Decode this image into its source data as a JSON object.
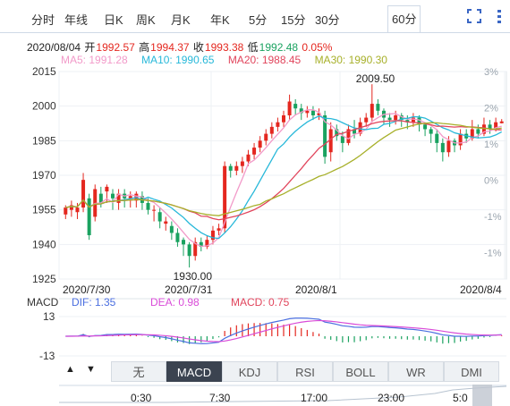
{
  "tabs": [
    "分时",
    "年线",
    "日K",
    "周K",
    "月K",
    "年K",
    "5分",
    "15分",
    "30分",
    "60分"
  ],
  "active_tab": "60分",
  "info": {
    "date": "2020/08/04",
    "open_label": "开",
    "open": "1992.57",
    "high_label": "高",
    "high": "1994.37",
    "close_label": "收",
    "close": "1993.38",
    "low_label": "低",
    "low": "1992.48",
    "change": "0.05%"
  },
  "ma_legend": [
    {
      "label": "MA5: 1991.28",
      "color": "#f29ac9"
    },
    {
      "label": "MA10: 1990.65",
      "color": "#27b8d9"
    },
    {
      "label": "MA20: 1988.45",
      "color": "#e1455c"
    },
    {
      "label": "MA30: 1990.30",
      "color": "#a7b02a"
    }
  ],
  "macd_legend": {
    "title": "MACD",
    "dif": {
      "label": "DIF: 1.35",
      "color": "#4b6fe0"
    },
    "dea": {
      "label": "DEA: 0.98",
      "color": "#d94bd8"
    },
    "macd": {
      "label": "MACD: 0.75",
      "color": "#e1455c"
    }
  },
  "indicator_buttons": [
    "无",
    "MACD",
    "KDJ",
    "RSI",
    "BOLL",
    "WR",
    "DMI"
  ],
  "active_indicator": "MACD",
  "timeline_labels": [
    "0:30",
    "7:30",
    "17:00",
    "23:00",
    "5:0"
  ],
  "colors": {
    "up": "#e4271f",
    "down": "#1aa260"
  },
  "chart_data": {
    "type": "candlestick",
    "y_left_ticks": [
      "2015",
      "2000",
      "1985",
      "1970",
      "1955",
      "1940",
      "1925"
    ],
    "y_right_ticks": [
      "3%",
      "2%",
      "1%",
      "0%",
      "-1%",
      "-1%"
    ],
    "x_labels": [
      "2020/7/30",
      "2020/7/31",
      "2020/8/1",
      "2020/8/4"
    ],
    "ylim": [
      1925,
      2015
    ],
    "annotations": [
      {
        "text": "2009.50",
        "value": 2009.5
      },
      {
        "text": "1930.00",
        "value": 1930.0
      }
    ],
    "candles": [
      [
        1953,
        1956,
        1951,
        1957
      ],
      [
        1955,
        1957,
        1952,
        1959
      ],
      [
        1954,
        1956,
        1951,
        1958
      ],
      [
        1956,
        1968,
        1954,
        1971
      ],
      [
        1960,
        1944,
        1942,
        1962
      ],
      [
        1952,
        1964,
        1950,
        1966
      ],
      [
        1962,
        1958,
        1956,
        1965
      ],
      [
        1963,
        1965,
        1958,
        1966
      ],
      [
        1962,
        1960,
        1955,
        1964
      ],
      [
        1958,
        1962,
        1955,
        1964
      ],
      [
        1962,
        1960,
        1956,
        1964
      ],
      [
        1960,
        1961,
        1956,
        1963
      ],
      [
        1959,
        1962,
        1956,
        1963
      ],
      [
        1961,
        1958,
        1955,
        1963
      ],
      [
        1958,
        1955,
        1953,
        1960
      ],
      [
        1955,
        1955,
        1950,
        1957
      ],
      [
        1954,
        1950,
        1947,
        1956
      ],
      [
        1949,
        1950,
        1946,
        1952
      ],
      [
        1948,
        1945,
        1942,
        1950
      ],
      [
        1945,
        1941,
        1939,
        1947
      ],
      [
        1942,
        1940,
        1935,
        1943
      ],
      [
        1940,
        1935,
        1930,
        1941
      ],
      [
        1935,
        1941,
        1933,
        1943
      ],
      [
        1941,
        1939,
        1937,
        1943
      ],
      [
        1939,
        1942,
        1938,
        1944
      ],
      [
        1942,
        1946,
        1940,
        1948
      ],
      [
        1946,
        1947,
        1944,
        1949
      ],
      [
        1947,
        1974,
        1945,
        1976
      ],
      [
        1974,
        1972,
        1969,
        1975
      ],
      [
        1972,
        1974,
        1970,
        1976
      ],
      [
        1974,
        1976,
        1971,
        1978
      ],
      [
        1976,
        1979,
        1974,
        1981
      ],
      [
        1979,
        1982,
        1977,
        1984
      ],
      [
        1982,
        1985,
        1980,
        1987
      ],
      [
        1985,
        1988,
        1983,
        1990
      ],
      [
        1988,
        1991,
        1986,
        1993
      ],
      [
        1991,
        1993,
        1989,
        1995
      ],
      [
        1993,
        1996,
        1991,
        1998
      ],
      [
        1996,
        2002,
        1994,
        2005
      ],
      [
        2001,
        1999,
        1996,
        2003
      ],
      [
        1999,
        1997,
        1994,
        2001
      ],
      [
        1997,
        1998,
        1995,
        2000
      ],
      [
        1998,
        1996,
        1994,
        2000
      ],
      [
        1996,
        1997,
        1994,
        1999
      ],
      [
        1996,
        1978,
        1975,
        1998
      ],
      [
        1980,
        1990,
        1976,
        1993
      ],
      [
        1990,
        1987,
        1985,
        1992
      ],
      [
        1987,
        1984,
        1980,
        1989
      ],
      [
        1984,
        1990,
        1983,
        1992
      ],
      [
        1990,
        1988,
        1986,
        1994
      ],
      [
        1988,
        1993,
        1987,
        1995
      ],
      [
        1993,
        1995,
        1991,
        1997
      ],
      [
        1995,
        2001,
        1993,
        2009.5
      ],
      [
        2001,
        1998,
        1996,
        2003
      ],
      [
        1998,
        1995,
        1992,
        1999
      ],
      [
        1995,
        1994,
        1991,
        1997
      ],
      [
        1994,
        1996,
        1992,
        1998
      ],
      [
        1996,
        1994,
        1991,
        1997
      ],
      [
        1994,
        1993,
        1990,
        1996
      ],
      [
        1993,
        1995,
        1991,
        1997
      ],
      [
        1995,
        1992,
        1989,
        1996
      ],
      [
        1992,
        1990,
        1987,
        1993
      ],
      [
        1990,
        1988,
        1984,
        1991
      ],
      [
        1988,
        1984,
        1980,
        1990
      ],
      [
        1984,
        1980,
        1976,
        1986
      ],
      [
        1980,
        1985,
        1978,
        1987
      ],
      [
        1985,
        1983,
        1980,
        1986
      ],
      [
        1983,
        1988,
        1981,
        1990
      ],
      [
        1988,
        1986,
        1984,
        1990
      ],
      [
        1986,
        1990,
        1985,
        1994
      ],
      [
        1990,
        1988,
        1986,
        1992
      ],
      [
        1988,
        1992,
        1987,
        1995
      ],
      [
        1992,
        1990,
        1988,
        1994
      ],
      [
        1990,
        1993,
        1989,
        1995
      ],
      [
        1992.57,
        1993.38,
        1992.48,
        1994.37
      ]
    ],
    "ma5_label": "MA5",
    "ma10_label": "MA10",
    "ma20_label": "MA20",
    "ma30_label": "MA30",
    "macd_ylim": [
      -13,
      13
    ],
    "macd_ticks": [
      "13",
      "-13"
    ]
  }
}
